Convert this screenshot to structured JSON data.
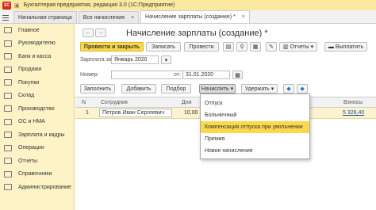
{
  "titlebar": {
    "logo": "1С",
    "title": "Бухгалтерия предприятия, редакция 3.0  (1С:Предприятие)"
  },
  "tabs": [
    {
      "label": "Начальная страница",
      "close": ""
    },
    {
      "label": "Все начисления",
      "close": "×"
    },
    {
      "label": "Начисление зарплаты (создание) *",
      "close": "×"
    }
  ],
  "sidebar": {
    "items": [
      "Главное",
      "Руководителю",
      "Банк и касса",
      "Продажи",
      "Покупки",
      "Склад",
      "Производство",
      "ОС и НМА",
      "Зарплата и кадры",
      "Операции",
      "Отчеты",
      "Справочники",
      "Администрирование"
    ]
  },
  "doc": {
    "title": "Начисление зарплаты (создание) *",
    "nav_back": "←",
    "nav_forward": "→",
    "post_close": "Провести и закрыть",
    "save": "Записать",
    "post": "Провести",
    "reports": "Отчеты",
    "pay": "Выплатить",
    "month_label": "Зарплата за:",
    "month_value": "Январь 2020",
    "number_label": "Номер:",
    "date_label": "от:",
    "date_value": "31.01.2020",
    "fill": "Заполнить",
    "add": "Добавить",
    "select": "Подбор",
    "accrue": "Начислить",
    "withhold": "Удержать"
  },
  "table": {
    "headers": {
      "n": "N",
      "employee": "Сотрудник",
      "days": "Дни",
      "contrib": "Взносы"
    },
    "rows": [
      {
        "n": "1",
        "employee": "Петров Иван Сергеевич",
        "days": "10,00",
        "contrib": "5 326,40"
      }
    ]
  },
  "dropdown": {
    "items": [
      "Отпуск",
      "Больничный",
      "Компенсация отпуска при увольнении",
      "Премия",
      "Новое начисление"
    ],
    "highlighted": "Компенсация отпуска при увольнении"
  },
  "colors": {
    "sidebar": "#fdf3c7",
    "primary": "#fbd94c",
    "titlebar": "#fbe9a0",
    "link": "#1a4fa0"
  }
}
